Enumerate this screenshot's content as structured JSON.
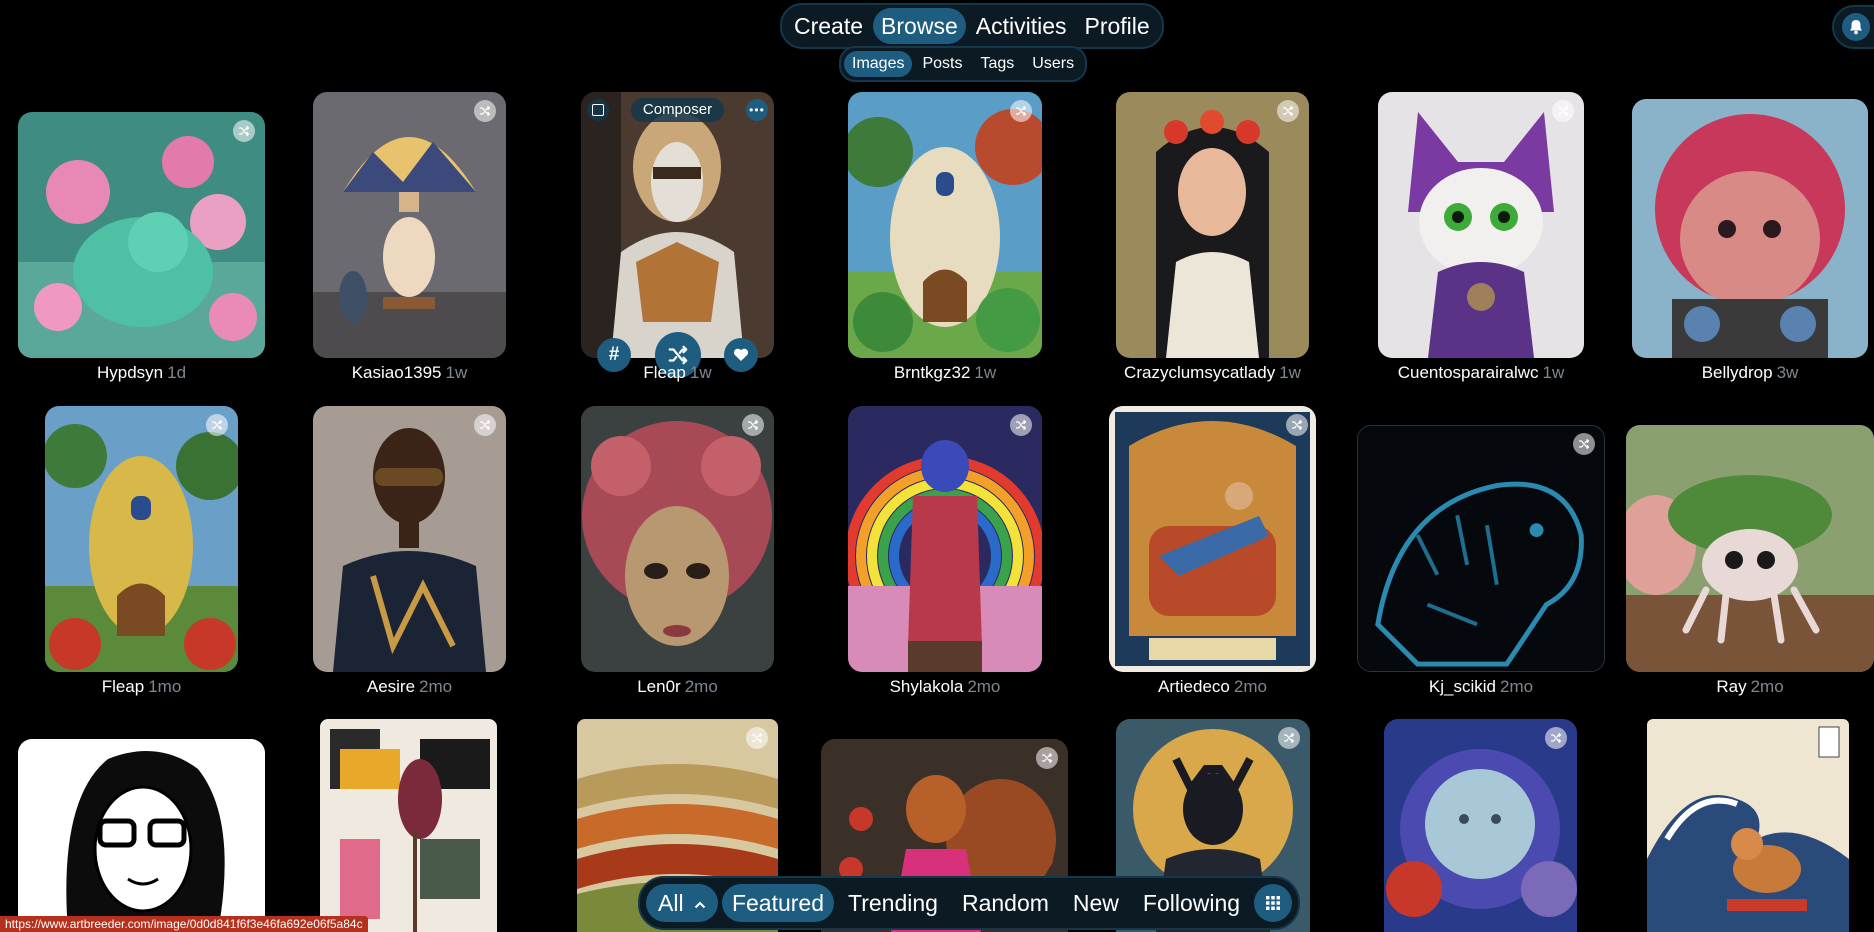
{
  "nav": {
    "tabs": [
      {
        "label": "Create"
      },
      {
        "label": "Browse"
      },
      {
        "label": "Activities"
      },
      {
        "label": "Profile"
      }
    ],
    "subtabs": [
      {
        "label": "Images"
      },
      {
        "label": "Posts"
      },
      {
        "label": "Tags"
      },
      {
        "label": "Users"
      }
    ],
    "active_tab": "Browse",
    "active_subtab": "Images"
  },
  "icons": {
    "notification": "bell-icon",
    "settings": "gear-icon",
    "remix": "shuffle-icon",
    "select": "checkbox-icon",
    "more": "more-icon",
    "tag": "hash-icon",
    "favorite": "heart-icon",
    "layout": "grid-icon"
  },
  "cards": [
    {
      "user": "Hypdsyn",
      "age": "1d"
    },
    {
      "user": "Kasiao1395",
      "age": "1w"
    },
    {
      "user": "Fleap",
      "age": "1w",
      "overlay_label": "Composer"
    },
    {
      "user": "Brntkgz32",
      "age": "1w"
    },
    {
      "user": "Crazyclumsycatlady",
      "age": "1w"
    },
    {
      "user": "Cuentosparairalwc",
      "age": "1w"
    },
    {
      "user": "Bellydrop",
      "age": "3w"
    },
    {
      "user": "Fleap",
      "age": "1mo"
    },
    {
      "user": "Aesire",
      "age": "2mo"
    },
    {
      "user": "Len0r",
      "age": "2mo"
    },
    {
      "user": "Shylakola",
      "age": "2mo"
    },
    {
      "user": "Artiedeco",
      "age": "2mo"
    },
    {
      "user": "Kj_scikid",
      "age": "2mo"
    },
    {
      "user": "Ray",
      "age": "2mo"
    }
  ],
  "filters": {
    "scope_label": "All",
    "items": [
      {
        "label": "Featured"
      },
      {
        "label": "Trending"
      },
      {
        "label": "Random"
      },
      {
        "label": "New"
      },
      {
        "label": "Following"
      }
    ],
    "active": "Featured"
  },
  "status_url": "https://www.artbreeder.com/image/0d0d841f6f3e46fa692e06f5a84c",
  "colors": {
    "background": "#000000",
    "accent": "#1e5d80",
    "bar": "#0c1a24",
    "status_bar": "#b6301e"
  }
}
